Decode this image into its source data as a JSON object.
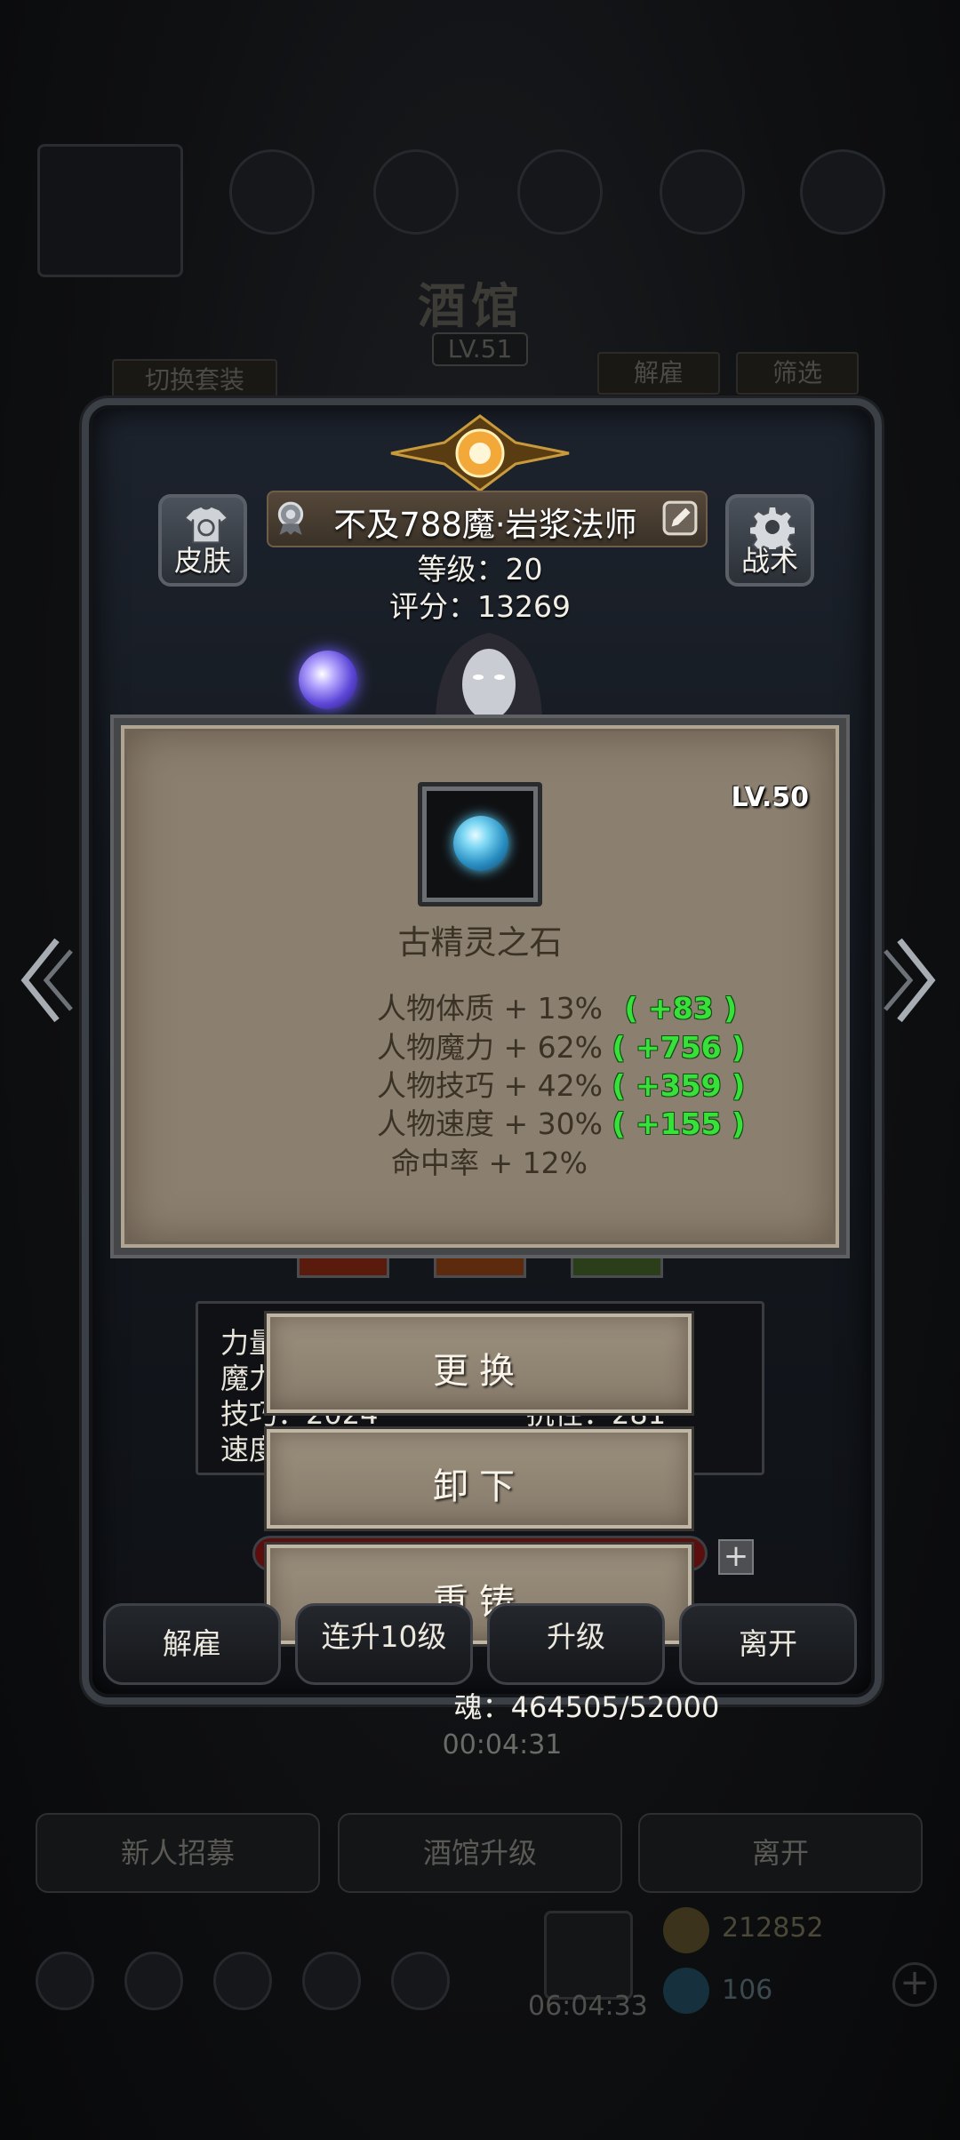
{
  "background": {
    "tavern_title": "酒馆",
    "tavern_level": "LV.51",
    "switch_outfit": "切换套装",
    "dismiss_tab": "解雇",
    "filter_tab": "筛选",
    "timer": "00:04:31",
    "recruit_button": "新人招募",
    "upgrade_tavern_button": "酒馆升级",
    "leave_button": "离开",
    "gold": "212852",
    "gems": "106",
    "bottom_timer": "06:04:33"
  },
  "hero": {
    "skin_label": "皮肤",
    "tactics_label": "战术",
    "name": "不及788魔·岩浆法师",
    "level_line": "等级：20",
    "score_line": "评分：13269"
  },
  "item": {
    "level": "LV.50",
    "name": "古精灵之石",
    "attributes": [
      {
        "label": "人物体质 + 13%",
        "bonus": "( +83 )"
      },
      {
        "label": "人物魔力 + 62%",
        "bonus": "( +756 )"
      },
      {
        "label": "人物技巧 + 42%",
        "bonus": "( +359 )"
      },
      {
        "label": "人物速度 + 30%",
        "bonus": "( +155 )"
      },
      {
        "label": "命中率 + 12%",
        "bonus": ""
      }
    ]
  },
  "stats_box": {
    "row1": "力量",
    "row2": "魔力",
    "row3_a": "技巧：2024",
    "row3_b": "抗性：281",
    "row4": "速度"
  },
  "actions": {
    "replace": "更换",
    "unequip": "卸下",
    "reforge": "重铸"
  },
  "hero_buttons": {
    "dismiss": "解雇",
    "upgrade10": "连升10级",
    "upgrade": "升级",
    "leave": "离开"
  },
  "soul": "魂：464505/52000",
  "colors": {
    "bonus_green": "#38e03a",
    "card_parchment": "#8b7f6f",
    "panel_frame": "#3b3f46"
  }
}
